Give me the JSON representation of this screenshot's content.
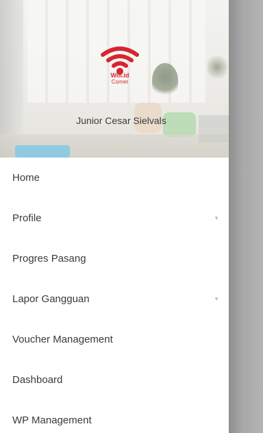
{
  "header": {
    "logo_line1": "Wifi.id",
    "logo_line2": "Corner",
    "user_name": "Junior Cesar Sielvals",
    "brand_color": "#d6262f"
  },
  "menu": {
    "items": [
      {
        "label": "Home",
        "icon": null
      },
      {
        "label": "Profile",
        "icon": "chevron-down-icon"
      },
      {
        "label": "Progres Pasang",
        "icon": null
      },
      {
        "label": "Lapor Gangguan",
        "icon": "chevron-down-icon"
      },
      {
        "label": "Voucher Management",
        "icon": null
      },
      {
        "label": "Dashboard",
        "icon": null
      },
      {
        "label": "WP Management",
        "icon": null
      }
    ]
  }
}
